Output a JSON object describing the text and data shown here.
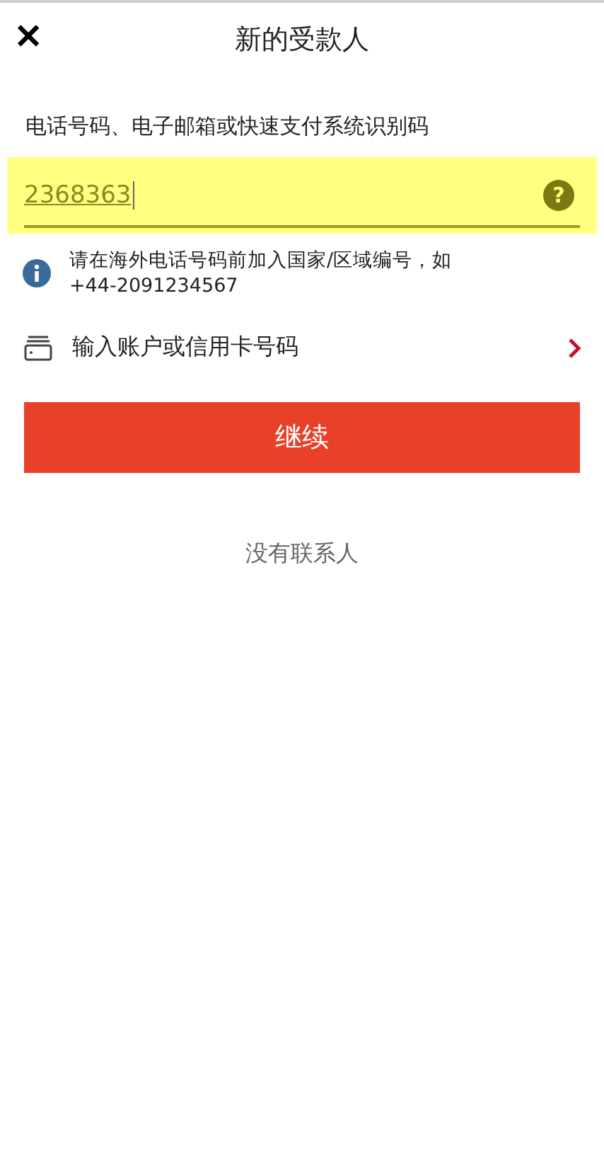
{
  "header": {
    "close": "✕",
    "title": "新的受款人"
  },
  "field": {
    "label": "电话号码、电子邮箱或快速支付系统识别码",
    "value": "2368363",
    "help": "?"
  },
  "info": {
    "text": "请在海外电话号码前加入国家/区域编号，如 +44-2091234567"
  },
  "account_link": {
    "label": "输入账户或信用卡号码"
  },
  "continue_button": "继续",
  "empty_contacts": "没有联系人"
}
